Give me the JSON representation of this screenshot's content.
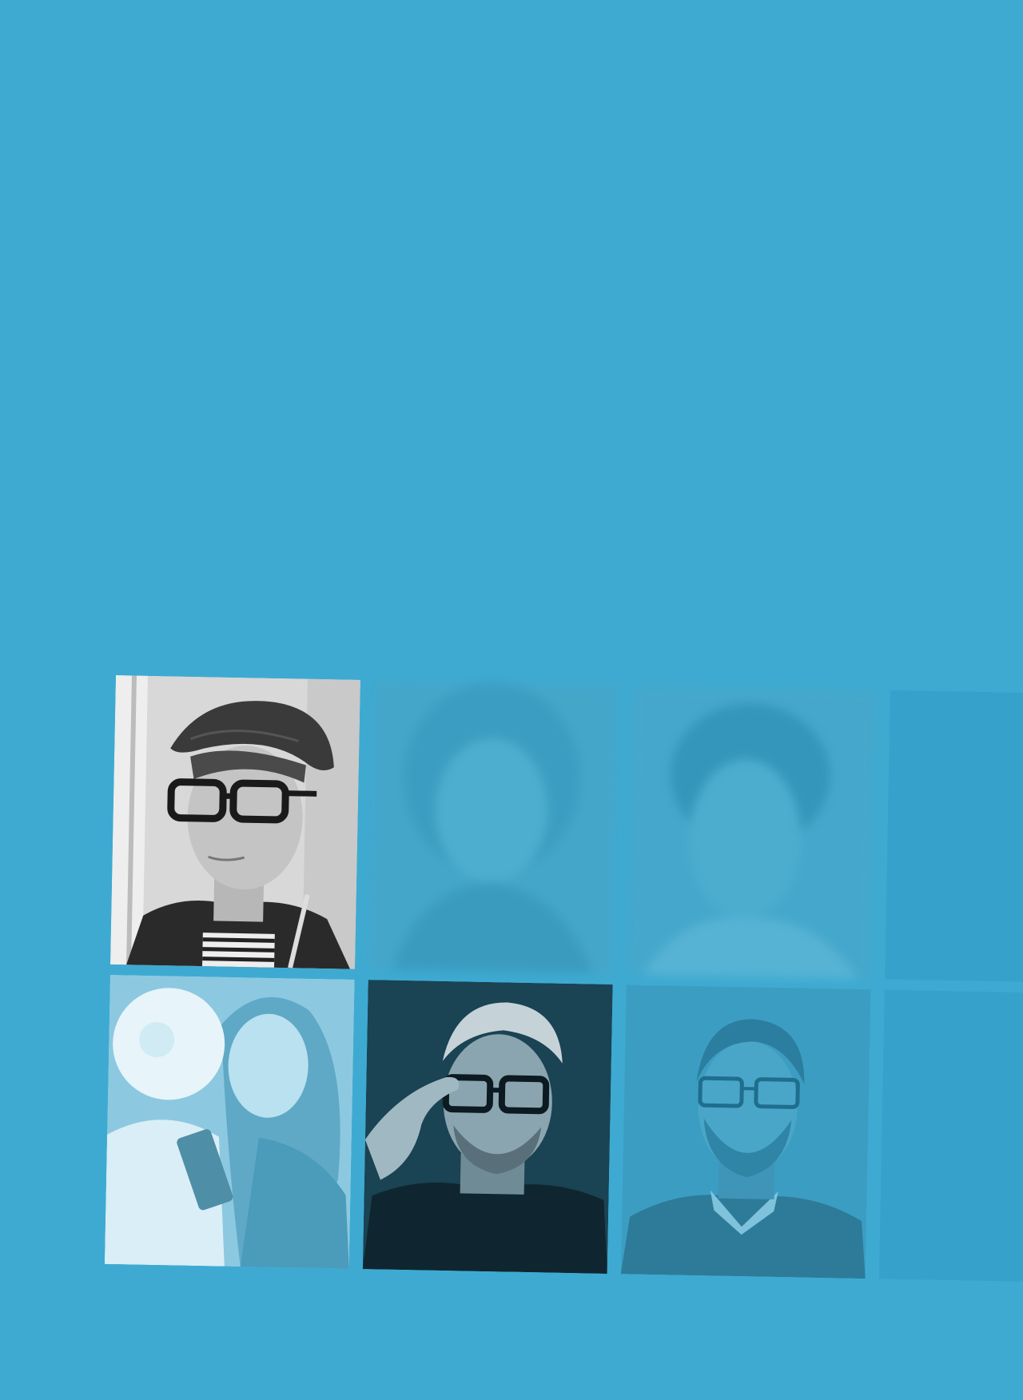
{
  "page": {
    "background_color": "#3eaad1"
  },
  "grid": {
    "rows": [
      {
        "tiles": [
          {
            "id": "portrait-man-cap-glasses",
            "style": "grayscale"
          },
          {
            "id": "portrait-woman-blurred",
            "style": "blue-tint-blurred"
          },
          {
            "id": "portrait-man-blurred",
            "style": "blue-tint-blurred"
          },
          {
            "id": "empty-tile",
            "style": "placeholder"
          }
        ]
      },
      {
        "tiles": [
          {
            "id": "portrait-woman-robot",
            "style": "light-blue-tint"
          },
          {
            "id": "portrait-man-glasses-hand",
            "style": "dark-teal"
          },
          {
            "id": "portrait-man-beard-glasses",
            "style": "blue-tint"
          },
          {
            "id": "empty-tile",
            "style": "placeholder"
          }
        ]
      }
    ]
  },
  "colors": {
    "placeholder": "#35a0c8",
    "blur_tint": "#4aa9c9",
    "dark_teal": "#17404f",
    "blue_tint": "#3d9ec2",
    "light_blue": "#9fd3e6",
    "grayscale_bg": "#d9d9d9"
  }
}
